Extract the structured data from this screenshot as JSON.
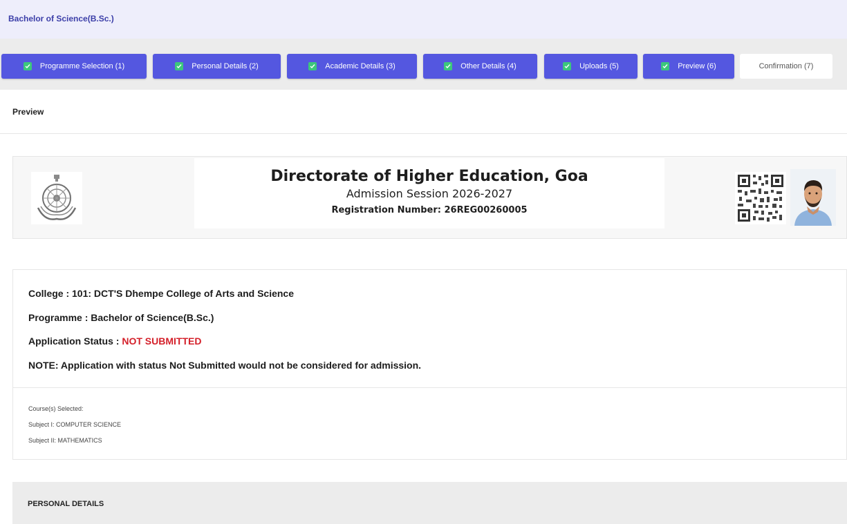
{
  "programme_title": "Bachelor of Science(B.Sc.)",
  "steps": [
    {
      "label": "Programme Selection  (1)",
      "done": true
    },
    {
      "label": "Personal Details  (2)",
      "done": true
    },
    {
      "label": "Academic Details  (3)",
      "done": true
    },
    {
      "label": "Other Details  (4)",
      "done": true
    },
    {
      "label": "Uploads  (5)",
      "done": true
    },
    {
      "label": "Preview  (6)",
      "done": true
    },
    {
      "label": "Confirmation  (7)",
      "done": false
    }
  ],
  "section_title": "Preview",
  "header": {
    "org": "Directorate of Higher Education, Goa",
    "session": "Admission Session 2026-2027",
    "registration": "Registration Number: 26REG00260005"
  },
  "info": {
    "college": "College : 101: DCT'S Dhempe College of Arts and Science",
    "programme": "Programme : Bachelor of Science(B.Sc.)",
    "status_label": "Application Status : ",
    "status_value": "NOT SUBMITTED",
    "note": "NOTE: Application with status Not Submitted would not be considered for admission."
  },
  "courses": {
    "heading": "Course(s) Selected:",
    "subject1": "Subject I: COMPUTER SCIENCE",
    "subject2": "Subject II: MATHEMATICS"
  },
  "personal_details_title": "PERSONAL DETAILS",
  "colors": {
    "accent": "#5457e0",
    "check": "#3cc77c",
    "status_red": "#d4202a"
  },
  "icons": [
    "check-icon",
    "government-emblem-icon",
    "qr-code-icon",
    "applicant-photo"
  ]
}
